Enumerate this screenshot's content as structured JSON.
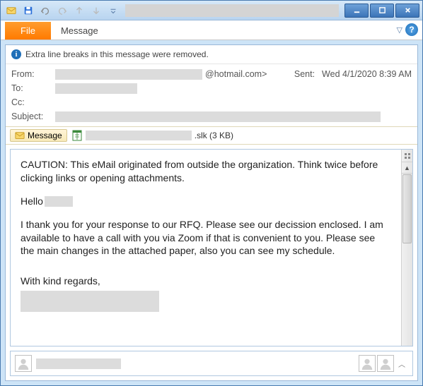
{
  "titlebar": {
    "title_redacted": true
  },
  "ribbon": {
    "file_label": "File",
    "message_label": "Message"
  },
  "infobar": {
    "text": "Extra line breaks in this message were removed."
  },
  "headers": {
    "from_label": "From:",
    "from_value": "@hotmail.com>",
    "to_label": "To:",
    "cc_label": "Cc:",
    "subject_label": "Subject:",
    "sent_label": "Sent:",
    "sent_value": "Wed 4/1/2020 8:39 AM"
  },
  "attach": {
    "message_pill": "Message",
    "file_suffix": ".slk (3 KB)"
  },
  "body": {
    "caution": "CAUTION: This eMail originated from outside the organization. Think twice before clicking links or opening attachments.",
    "hello": "Hello",
    "para1": "I thank you for your response to our RFQ. Please see our decission enclosed. I am available to have a call with you via Zoom if that is convenient to you. Please see the main changes in the attached paper, also you can see my schedule.",
    "signoff": "With kind regards,"
  }
}
